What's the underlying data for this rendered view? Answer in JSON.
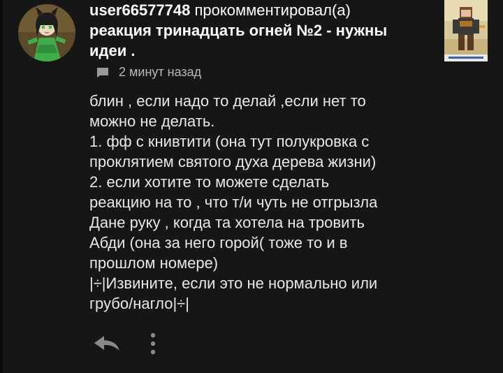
{
  "comment_header": {
    "username": "user66577748",
    "action_text": " прокомментировал(а)",
    "post_title_line1": "реакция тринадцать огней №2 - нужны",
    "post_title_line2": "идеи ."
  },
  "meta": {
    "icon": "chat-bubble-icon",
    "time_text": "2 минут назад"
  },
  "comment_body": {
    "lines": [
      "блин , если надо то делай ,если нет то",
      "можно не делать.",
      "1. фф с книвтити (она тут полукровка с",
      "проклятием святого духа дерева жизни)",
      "2. если хотите то можете сделать",
      "реакцию на то , что т/и чуть не отгрызла",
      "Дане руку , когда та хотела на тровить",
      "Абди (она за него горой( тоже то и в",
      "прошлом номере)",
      "|÷|Извините, если это не нормально или",
      "грубо/нагло|÷|"
    ]
  },
  "actions": {
    "reply_icon": "reply-arrow-icon",
    "more_icon": "more-vertical-icon"
  },
  "colors": {
    "background": "#161616",
    "text": "#e8e8e8",
    "muted": "#b8b8b8"
  }
}
